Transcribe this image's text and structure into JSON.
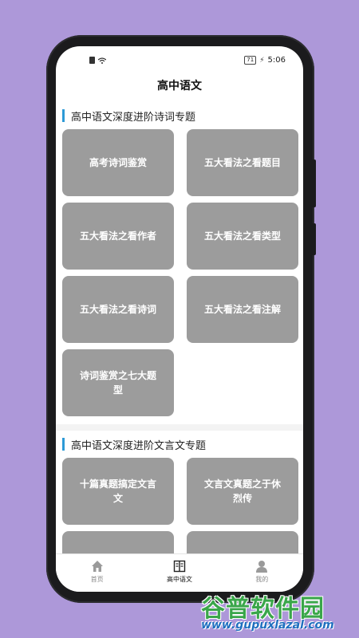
{
  "status": {
    "battery": "71",
    "time": "5:06"
  },
  "appbar": {
    "title": "高中语文"
  },
  "sections": [
    {
      "title": "高中语文深度进阶诗词专题",
      "cards": [
        "高考诗词鉴赏",
        "五大看法之看题目",
        "五大看法之看作者",
        "五大看法之看类型",
        "五大看法之看诗词",
        "五大看法之看注解",
        "诗词鉴赏之七大题型"
      ]
    },
    {
      "title": "高中语文深度进阶文言文专题",
      "cards": [
        "十篇真题搞定文言文",
        "文言文真题之于休烈传",
        "",
        ""
      ]
    }
  ],
  "tabs": [
    {
      "label": "首页",
      "icon": "home-icon"
    },
    {
      "label": "高中语文",
      "icon": "book-icon"
    },
    {
      "label": "我的",
      "icon": "user-icon"
    }
  ],
  "colors": {
    "accent": "#2d9ad6",
    "card": "#9c9c9c",
    "background": "#ad98d9"
  },
  "watermark": {
    "title": "谷普软件园",
    "url": "www.gupuxlazal.com"
  }
}
